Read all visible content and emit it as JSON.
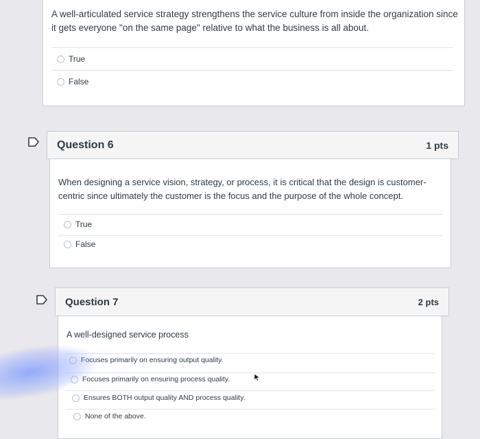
{
  "question5": {
    "text": "A well-articulated service strategy strengthens the service culture from inside the organization since it gets everyone \"on the same page\" relative to what the business is all about.",
    "options": [
      "True",
      "False"
    ]
  },
  "question6": {
    "title": "Question 6",
    "points": "1 pts",
    "text": "When designing a service vision, strategy, or process, it is critical that the design is customer-centric since ultimately the customer is the focus and the purpose of the whole concept.",
    "options": [
      "True",
      "False"
    ]
  },
  "question7": {
    "title": "Question 7",
    "points": "2 pts",
    "text": "A well-designed service process",
    "options": [
      "Focuses primarily on ensuring output quality.",
      "Focuses primarily on ensuring process quality.",
      "Ensures BOTH output quality AND process quality.",
      "None of the above."
    ]
  },
  "colors": {
    "page_bg": "#e9e8ec",
    "header_bg": "#f5f5f5",
    "border": "#c7cdd1",
    "text": "#2d3b45"
  }
}
